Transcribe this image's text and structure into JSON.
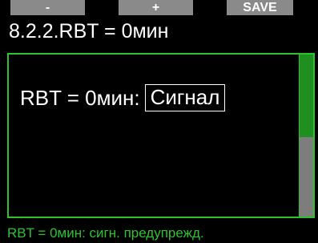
{
  "softkeys": {
    "minus_label": "-",
    "plus_label": "+",
    "save_label": "SAVE"
  },
  "header": {
    "title": "8.2.2.RBT = 0мин"
  },
  "setting": {
    "label": "RBT = 0мин:",
    "value": "Сигнал"
  },
  "scrollbar": {
    "position_fraction": 0.0,
    "visible_fraction": 0.51
  },
  "status": {
    "text": "RBT = 0мин: сигн. предупрежд."
  },
  "colors": {
    "accent_green": "#2ec32e",
    "scrollbar_thumb": "#1f8f1f",
    "scrollbar_track": "#7d7d7d",
    "softkey_bg": "#8a8a8a"
  }
}
